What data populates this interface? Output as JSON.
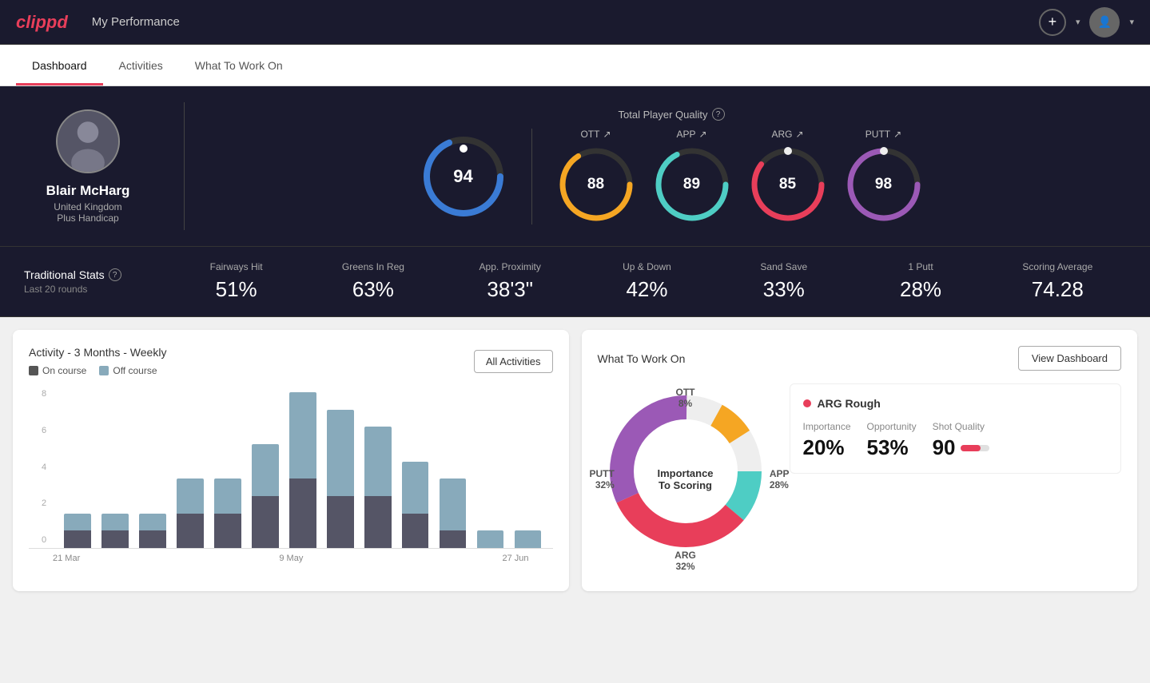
{
  "app": {
    "logo": "clippd",
    "header_title": "My Performance"
  },
  "tabs": [
    {
      "id": "dashboard",
      "label": "Dashboard",
      "active": true
    },
    {
      "id": "activities",
      "label": "Activities",
      "active": false
    },
    {
      "id": "what-to-work-on",
      "label": "What To Work On",
      "active": false
    }
  ],
  "player": {
    "name": "Blair McHarg",
    "country": "United Kingdom",
    "handicap": "Plus Handicap"
  },
  "quality": {
    "section_label": "Total Player Quality",
    "total": {
      "value": "94",
      "color": "#3a7bd5"
    },
    "metrics": [
      {
        "id": "ott",
        "label": "OTT",
        "value": "88",
        "color": "#f5a623",
        "trend": "↗"
      },
      {
        "id": "app",
        "label": "APP",
        "value": "89",
        "color": "#4ecdc4",
        "trend": "↗"
      },
      {
        "id": "arg",
        "label": "ARG",
        "value": "85",
        "color": "#e83e5a",
        "trend": "↗"
      },
      {
        "id": "putt",
        "label": "PUTT",
        "value": "98",
        "color": "#9b59b6",
        "trend": "↗"
      }
    ]
  },
  "traditional_stats": {
    "label": "Traditional Stats",
    "sublabel": "Last 20 rounds",
    "items": [
      {
        "name": "Fairways Hit",
        "value": "51%"
      },
      {
        "name": "Greens In Reg",
        "value": "63%"
      },
      {
        "name": "App. Proximity",
        "value": "38'3\""
      },
      {
        "name": "Up & Down",
        "value": "42%"
      },
      {
        "name": "Sand Save",
        "value": "33%"
      },
      {
        "name": "1 Putt",
        "value": "28%"
      },
      {
        "name": "Scoring Average",
        "value": "74.28"
      }
    ]
  },
  "activity_chart": {
    "title": "Activity - 3 Months - Weekly",
    "legend_on_course": "On course",
    "legend_off_course": "Off course",
    "all_activities_btn": "All Activities",
    "x_labels": [
      "21 Mar",
      "9 May",
      "27 Jun"
    ],
    "y_labels": [
      "8",
      "6",
      "4",
      "2",
      "0"
    ],
    "bars": [
      {
        "on": 1,
        "off": 1
      },
      {
        "on": 1,
        "off": 1
      },
      {
        "on": 1,
        "off": 1
      },
      {
        "on": 2,
        "off": 2
      },
      {
        "on": 2,
        "off": 2
      },
      {
        "on": 3,
        "off": 3
      },
      {
        "on": 4,
        "off": 5
      },
      {
        "on": 3,
        "off": 5
      },
      {
        "on": 3,
        "off": 4
      },
      {
        "on": 2,
        "off": 3
      },
      {
        "on": 1,
        "off": 3
      },
      {
        "on": 0,
        "off": 1
      },
      {
        "on": 0,
        "off": 1
      }
    ]
  },
  "what_to_work_on": {
    "title": "What To Work On",
    "view_dashboard_btn": "View Dashboard",
    "segments": [
      {
        "id": "ott",
        "label": "OTT",
        "pct": "8%",
        "color": "#f5a623"
      },
      {
        "id": "app",
        "label": "APP",
        "pct": "28%",
        "color": "#4ecdc4"
      },
      {
        "id": "arg",
        "label": "ARG",
        "pct": "32%",
        "color": "#e83e5a"
      },
      {
        "id": "putt",
        "label": "PUTT",
        "pct": "32%",
        "color": "#9b59b6"
      }
    ],
    "center_text_line1": "Importance",
    "center_text_line2": "To Scoring",
    "detail_card": {
      "title": "ARG Rough",
      "dot_color": "#e83e5a",
      "metrics": [
        {
          "label": "Importance",
          "value": "20%"
        },
        {
          "label": "Opportunity",
          "value": "53%"
        },
        {
          "label": "Shot Quality",
          "value": "90"
        }
      ]
    }
  },
  "header_actions": {
    "add_btn_label": "+",
    "dropdown_arrow": "▾"
  }
}
